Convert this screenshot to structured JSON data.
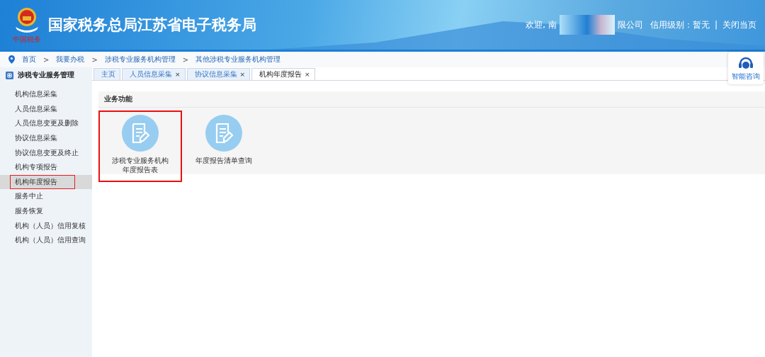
{
  "header": {
    "title": "国家税务总局江苏省电子税务局",
    "logo_caption": "中国税务",
    "welcome_prefix": "欢迎, 南",
    "welcome_suffix": "限公司",
    "credit_label": "信用级别：暂无",
    "separator": "|",
    "close_link": "关闭当页"
  },
  "breadcrumb": [
    {
      "label": "首页"
    },
    {
      "label": "我要办税"
    },
    {
      "label": "涉税专业服务机构管理"
    },
    {
      "label": "其他涉税专业服务机构管理"
    }
  ],
  "breadcrumb_separator": ">",
  "assistant": {
    "label": "智能咨询"
  },
  "sidebar": {
    "title": "涉税专业服务管理",
    "items": [
      {
        "label": "机构信息采集",
        "selected": false,
        "highlighted": false
      },
      {
        "label": "人员信息采集",
        "selected": false,
        "highlighted": false
      },
      {
        "label": "人员信息变更及删除",
        "selected": false,
        "highlighted": false
      },
      {
        "label": "协议信息采集",
        "selected": false,
        "highlighted": false
      },
      {
        "label": "协议信息变更及终止",
        "selected": false,
        "highlighted": false
      },
      {
        "label": "机构专项报告",
        "selected": false,
        "highlighted": false
      },
      {
        "label": "机构年度报告",
        "selected": true,
        "highlighted": true
      },
      {
        "label": "服务中止",
        "selected": false,
        "highlighted": false
      },
      {
        "label": "服务恢复",
        "selected": false,
        "highlighted": false
      },
      {
        "label": "机构（人员）信用复核",
        "selected": false,
        "highlighted": false
      },
      {
        "label": "机构（人员）信用查询",
        "selected": false,
        "highlighted": false
      }
    ]
  },
  "tabs": [
    {
      "label": "主页",
      "closable": false,
      "selected": false
    },
    {
      "label": "人员信息采集",
      "closable": true,
      "selected": false
    },
    {
      "label": "协议信息采集",
      "closable": true,
      "selected": false
    },
    {
      "label": "机构年度报告",
      "closable": true,
      "selected": true
    }
  ],
  "tab_close": "×",
  "panel": {
    "title": "业务功能",
    "cards": [
      {
        "lines": [
          "涉税专业服务机构",
          "年度报告表"
        ],
        "highlighted": true
      },
      {
        "lines": [
          "年度报告清单查询"
        ],
        "highlighted": false
      }
    ]
  }
}
